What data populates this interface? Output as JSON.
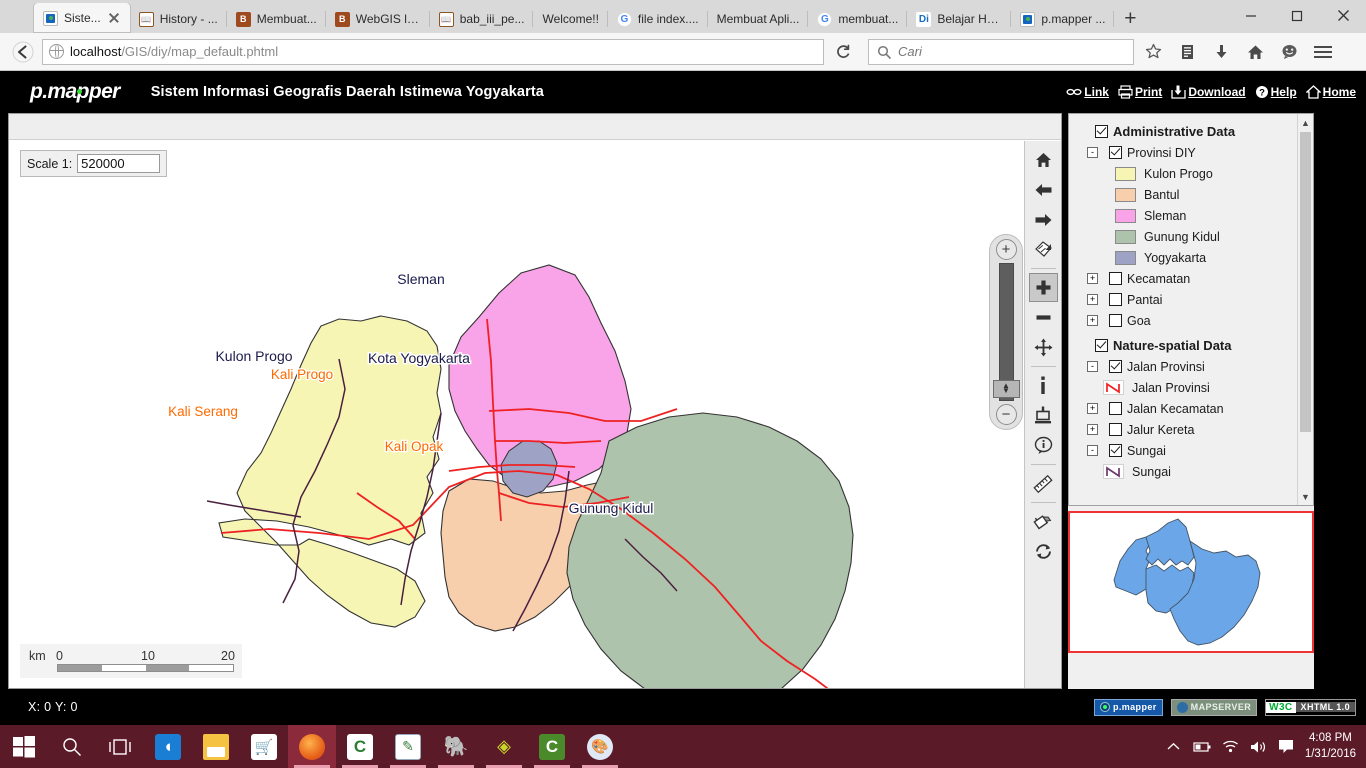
{
  "browser": {
    "tabs": [
      {
        "label": "Siste...",
        "favicon": "pmapper-icon",
        "active": true,
        "closable": true
      },
      {
        "label": "History - ...",
        "favicon": "book-icon",
        "active": false
      },
      {
        "label": "Membuat...",
        "favicon": "doc-icon",
        "active": false
      },
      {
        "label": "WebGIS lll...",
        "favicon": "doc-icon",
        "active": false
      },
      {
        "label": "bab_iii_pe...",
        "favicon": "book-icon",
        "active": false
      },
      {
        "label": "Welcome!!",
        "favicon": "none",
        "active": false
      },
      {
        "label": "file index....",
        "favicon": "google-icon",
        "active": false
      },
      {
        "label": "Membuat Apli...",
        "favicon": "none",
        "active": false
      },
      {
        "label": "membuat...",
        "favicon": "google-icon",
        "active": false
      },
      {
        "label": "Belajar HT...",
        "favicon": "di-icon",
        "active": false
      },
      {
        "label": "p.mapper ...",
        "favicon": "pmapper-icon",
        "active": false
      }
    ],
    "new_tab_label": "+",
    "url": {
      "host": "localhost",
      "path": "/GIS/diy/map_default.phtml"
    },
    "search_placeholder": "Cari",
    "nav": {
      "back": "back-arrow",
      "reload": "reload-icon",
      "bookmark": "star-icon",
      "library": "library-icon",
      "downloads": "download-arrow-icon",
      "home": "home-icon",
      "sync": "sync-icon",
      "menu": "hamburger-icon"
    },
    "window_controls": {
      "minimize": "minimize",
      "maximize": "maximize",
      "close": "close"
    }
  },
  "app": {
    "logo": "p.mapper",
    "title": "Sistem Informasi Geografis Daerah Istimewa Yogyakarta",
    "links": [
      {
        "label": "Link",
        "icon": "chain-icon"
      },
      {
        "label": "Print",
        "icon": "printer-icon"
      },
      {
        "label": "Download",
        "icon": "download-icon"
      },
      {
        "label": "Help",
        "icon": "question-icon"
      },
      {
        "label": "Home",
        "icon": "house-icon"
      }
    ]
  },
  "map": {
    "scale_label": "Scale 1:",
    "scale_value": "520000",
    "scalebar": {
      "unit": "km",
      "ticks": [
        "0",
        "10",
        "20"
      ]
    },
    "zoom_slider": {
      "zoom_in": "+",
      "zoom_out": "−"
    },
    "labels": [
      {
        "text": "Sleman",
        "type": "region"
      },
      {
        "text": "Kulon Progo",
        "type": "region"
      },
      {
        "text": "Kota Yogyakarta",
        "type": "region"
      },
      {
        "text": "Gunung Kidul",
        "type": "region"
      },
      {
        "text": "Kali Serang",
        "type": "river"
      },
      {
        "text": "Kali Progo",
        "type": "river"
      },
      {
        "text": "Kali Opak",
        "type": "river"
      }
    ],
    "colors": {
      "kulon_progo": "#f6f5b4",
      "bantul": "#f8cfac",
      "sleman": "#f9a3e8",
      "gunung_kidul": "#aec3ab",
      "yogyakarta": "#9ea3c6",
      "river": "#4a2040",
      "road": "#ee2222",
      "region_label": "#1b1b4b",
      "river_label": "#ff6a00"
    }
  },
  "toolbar": {
    "buttons": [
      {
        "name": "home-extent",
        "icon": "house-icon",
        "active": false
      },
      {
        "name": "previous-extent",
        "icon": "left-arrow-icon",
        "active": false
      },
      {
        "name": "next-extent",
        "icon": "right-arrow-icon",
        "active": false
      },
      {
        "name": "zoom-full-extent",
        "icon": "globe-extent-icon",
        "active": false
      },
      {
        "name": "zoom-in",
        "icon": "plus-icon",
        "active": true
      },
      {
        "name": "zoom-out",
        "icon": "minus-icon",
        "active": false
      },
      {
        "name": "pan",
        "icon": "pan-arrows-icon",
        "active": false
      },
      {
        "name": "identify",
        "icon": "info-i-icon",
        "active": false
      },
      {
        "name": "select",
        "icon": "select-icon",
        "active": false
      },
      {
        "name": "auto-identify",
        "icon": "info-balloon-icon",
        "active": false
      },
      {
        "name": "measure",
        "icon": "ruler-icon",
        "active": false
      },
      {
        "name": "highlight",
        "icon": "paint-bucket-icon",
        "active": false
      },
      {
        "name": "refresh",
        "icon": "refresh-icon",
        "active": false
      }
    ]
  },
  "legend": {
    "groups": [
      {
        "label": "Administrative Data",
        "bold": true,
        "checked": true,
        "toggle": null,
        "level": 0
      },
      {
        "label": "Provinsi DIY",
        "checked": true,
        "toggle": "-",
        "level": 1,
        "items": [
          {
            "label": "Kulon Progo",
            "color": "#f6f5b4"
          },
          {
            "label": "Bantul",
            "color": "#f8cfac"
          },
          {
            "label": "Sleman",
            "color": "#f9a3e8"
          },
          {
            "label": "Gunung Kidul",
            "color": "#aec3ab"
          },
          {
            "label": "Yogyakarta",
            "color": "#9ea3c6"
          }
        ]
      },
      {
        "label": "Kecamatan",
        "checked": false,
        "toggle": "+",
        "level": 1,
        "items": []
      },
      {
        "label": "Pantai",
        "checked": false,
        "toggle": "+",
        "level": 1,
        "items": []
      },
      {
        "label": "Goa",
        "checked": false,
        "toggle": "+",
        "level": 1,
        "items": []
      },
      {
        "label": "Nature-spatial Data",
        "bold": true,
        "checked": true,
        "toggle": null,
        "level": 0
      },
      {
        "label": "Jalan Provinsi",
        "checked": true,
        "toggle": "-",
        "level": 1,
        "lines": [
          {
            "label": "Jalan Provinsi",
            "color": "#ee2222"
          }
        ]
      },
      {
        "label": "Jalan Kecamatan",
        "checked": false,
        "toggle": "+",
        "level": 1,
        "lines": []
      },
      {
        "label": "Jalur Kereta",
        "checked": false,
        "toggle": "+",
        "level": 1,
        "lines": []
      },
      {
        "label": "Sungai",
        "checked": true,
        "toggle": "-",
        "level": 1,
        "lines": [
          {
            "label": "Sungai",
            "color": "#6b3a6b"
          }
        ]
      }
    ],
    "scrollbar": {
      "up": "▲",
      "down": "▼"
    }
  },
  "overview": {
    "border_color": "#ee3333",
    "fill_color": "#6aa6e8"
  },
  "footer": {
    "coords": "X: 0   Y: 0",
    "badges": [
      {
        "name": "pmapper-badge",
        "text": "p.mapper"
      },
      {
        "name": "mapserver-badge",
        "text": "MAPSERVER"
      },
      {
        "name": "w3c-badge",
        "left": "W3C",
        "right": "XHTML 1.0"
      }
    ]
  },
  "taskbar": {
    "items": [
      {
        "name": "start-button",
        "icon": "windows-logo"
      },
      {
        "name": "search-button",
        "icon": "magnifier-icon"
      },
      {
        "name": "task-view-button",
        "icon": "task-view-icon"
      },
      {
        "name": "edge-app",
        "icon": "edge-icon"
      },
      {
        "name": "file-explorer-app",
        "icon": "folder-icon"
      },
      {
        "name": "store-app",
        "icon": "store-icon"
      },
      {
        "name": "firefox-app",
        "icon": "firefox-icon"
      },
      {
        "name": "app-c-green",
        "icon": "c-icon"
      },
      {
        "name": "app-notepad",
        "icon": "notepad-icon"
      },
      {
        "name": "postgresql-app",
        "icon": "elephant-icon"
      },
      {
        "name": "app-green-yellow",
        "icon": "leaf-icon"
      },
      {
        "name": "app-c-green-2",
        "icon": "c-icon"
      },
      {
        "name": "paint-app",
        "icon": "palette-icon"
      }
    ],
    "tray": [
      {
        "name": "show-hidden-icons",
        "icon": "chevron-up-icon"
      },
      {
        "name": "battery-icon",
        "icon": "battery-icon"
      },
      {
        "name": "wifi-icon",
        "icon": "wifi-icon"
      },
      {
        "name": "volume-icon",
        "icon": "speaker-icon"
      },
      {
        "name": "action-center",
        "icon": "notification-icon"
      }
    ],
    "clock": {
      "time": "4:08 PM",
      "date": "1/31/2016"
    }
  }
}
